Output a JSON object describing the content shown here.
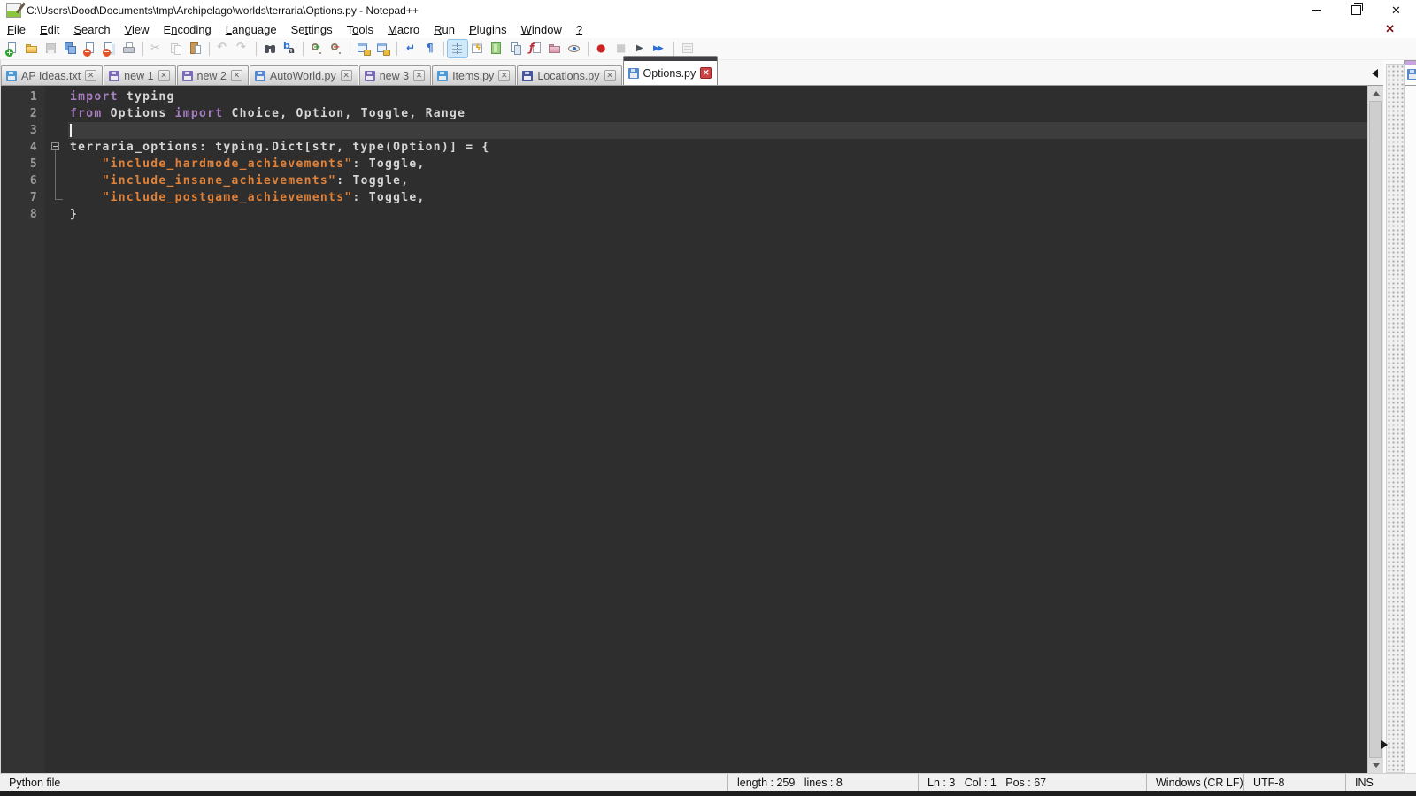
{
  "window": {
    "title": "C:\\Users\\Dood\\Documents\\tmp\\Archipelago\\worlds\\terraria\\Options.py - Notepad++"
  },
  "menu": {
    "items": [
      {
        "label": "File",
        "u": 0
      },
      {
        "label": "Edit",
        "u": 0
      },
      {
        "label": "Search",
        "u": 0
      },
      {
        "label": "View",
        "u": 0
      },
      {
        "label": "Encoding",
        "u": 1
      },
      {
        "label": "Language",
        "u": 0
      },
      {
        "label": "Settings",
        "u": 2
      },
      {
        "label": "Tools",
        "u": 1
      },
      {
        "label": "Macro",
        "u": 0
      },
      {
        "label": "Run",
        "u": 0
      },
      {
        "label": "Plugins",
        "u": 0
      },
      {
        "label": "Window",
        "u": 0
      },
      {
        "label": "?",
        "u": 0
      }
    ],
    "close_label": "✕"
  },
  "toolbar": {
    "groups": [
      [
        {
          "n": "new-file"
        },
        {
          "n": "open-file"
        },
        {
          "n": "save",
          "dis": true
        },
        {
          "n": "save-all"
        },
        {
          "n": "close-file"
        },
        {
          "n": "close-all"
        },
        {
          "n": "print"
        }
      ],
      [
        {
          "n": "cut",
          "dis": true
        },
        {
          "n": "copy",
          "dis": true
        },
        {
          "n": "paste"
        }
      ],
      [
        {
          "n": "undo",
          "dis": true
        },
        {
          "n": "redo",
          "dis": true
        }
      ],
      [
        {
          "n": "find"
        },
        {
          "n": "replace"
        }
      ],
      [
        {
          "n": "zoom-in"
        },
        {
          "n": "zoom-out"
        }
      ],
      [
        {
          "n": "sync-vertical"
        },
        {
          "n": "sync-horizontal"
        }
      ],
      [
        {
          "n": "word-wrap"
        },
        {
          "n": "show-all-chars"
        }
      ],
      [
        {
          "n": "indent-guide",
          "on": true
        },
        {
          "n": "user-defined-language"
        },
        {
          "n": "document-map"
        },
        {
          "n": "document-list"
        },
        {
          "n": "function-list"
        },
        {
          "n": "folder-as-workspace"
        },
        {
          "n": "monitoring"
        }
      ],
      [
        {
          "n": "macro-record"
        },
        {
          "n": "macro-stop",
          "dis": true
        },
        {
          "n": "macro-play"
        },
        {
          "n": "macro-run-multiple"
        }
      ],
      [
        {
          "n": "macro-save",
          "dis": true
        }
      ]
    ]
  },
  "tabs": {
    "items": [
      {
        "label": "AP Ideas.txt",
        "icon_color": "#4d9ad8",
        "active": false
      },
      {
        "label": "new 1",
        "icon_color": "#7d6bb8",
        "active": false
      },
      {
        "label": "new 2",
        "icon_color": "#7d6bb8",
        "active": false
      },
      {
        "label": "AutoWorld.py",
        "icon_color": "#5588cc",
        "active": false
      },
      {
        "label": "new 3",
        "icon_color": "#7d6bb8",
        "active": false
      },
      {
        "label": "Items.py",
        "icon_color": "#4d9ad8",
        "active": false
      },
      {
        "label": "Locations.py",
        "icon_color": "#46549c",
        "active": false
      },
      {
        "label": "Options.py",
        "icon_color": "#5588cc",
        "active": true
      }
    ],
    "close_glyph": "✕"
  },
  "editor": {
    "colors": {
      "keyword": "#a77fc0",
      "string": "#e0823a",
      "default": "#d6d6d6",
      "line_number": "#989898",
      "background": "#2e2e2e",
      "current_line": "#3d3d3d"
    },
    "lines": [
      {
        "n": "1",
        "fold": "",
        "tokens": [
          [
            "kw",
            "import"
          ],
          [
            "df",
            " typing"
          ]
        ]
      },
      {
        "n": "2",
        "fold": "",
        "tokens": [
          [
            "kw",
            "from"
          ],
          [
            "df",
            " Options "
          ],
          [
            "kw",
            "import"
          ],
          [
            "df",
            " Choice, Option, Toggle, Range"
          ]
        ]
      },
      {
        "n": "3",
        "fold": "",
        "current": true,
        "caret": true,
        "tokens": []
      },
      {
        "n": "4",
        "fold": "box",
        "tokens": [
          [
            "df",
            "terraria_options: typing.Dict[str, type(Option)] = {"
          ]
        ]
      },
      {
        "n": "5",
        "fold": "line",
        "tokens": [
          [
            "df",
            "    "
          ],
          [
            "str",
            "\"include_hardmode_achievements\""
          ],
          [
            "df",
            ": Toggle,"
          ]
        ]
      },
      {
        "n": "6",
        "fold": "line",
        "tokens": [
          [
            "df",
            "    "
          ],
          [
            "str",
            "\"include_insane_achievements\""
          ],
          [
            "df",
            ": Toggle,"
          ]
        ]
      },
      {
        "n": "7",
        "fold": "end",
        "tokens": [
          [
            "df",
            "    "
          ],
          [
            "str",
            "\"include_postgame_achievements\""
          ],
          [
            "df",
            ": Toggle,"
          ]
        ]
      },
      {
        "n": "8",
        "fold": "",
        "tokens": [
          [
            "df",
            "}"
          ]
        ]
      }
    ]
  },
  "status_bar": {
    "doc_type": "Python file",
    "length_lines": "length : 259   lines : 8",
    "position": "Ln : 3   Col : 1   Pos : 67",
    "eol": "Windows (CR LF)",
    "encoding": "UTF-8",
    "insert_mode": "INS"
  }
}
